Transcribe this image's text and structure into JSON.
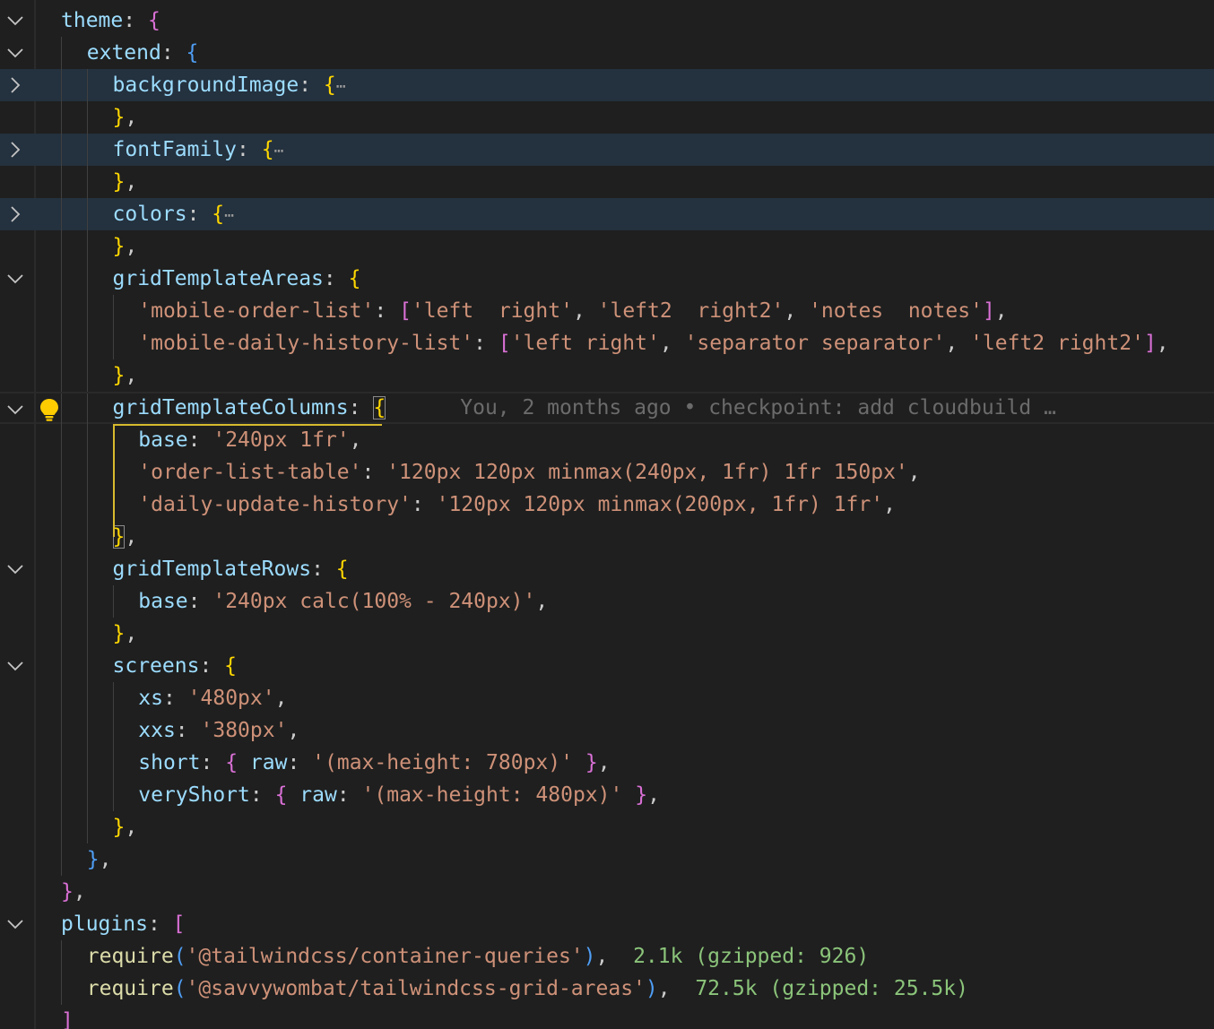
{
  "editor": {
    "lines": [
      {
        "fold": "open",
        "indent": 0,
        "tokens": [
          [
            "k",
            "theme"
          ],
          [
            "p",
            ": "
          ],
          [
            "b1",
            "{"
          ]
        ]
      },
      {
        "fold": "open",
        "indent": 1,
        "tokens": [
          [
            "k",
            "extend"
          ],
          [
            "p",
            ": "
          ],
          [
            "b2",
            "{"
          ]
        ]
      },
      {
        "fold": "closed",
        "indent": 2,
        "collapsed": true,
        "tokens": [
          [
            "k",
            "backgroundImage"
          ],
          [
            "p",
            ": "
          ],
          [
            "b3",
            "{"
          ]
        ],
        "ellipsis": "⋯"
      },
      {
        "indent": 2,
        "tokens": [
          [
            "b3",
            "}"
          ],
          [
            "p",
            ","
          ]
        ]
      },
      {
        "fold": "closed",
        "indent": 2,
        "collapsed": true,
        "tokens": [
          [
            "k",
            "fontFamily"
          ],
          [
            "p",
            ": "
          ],
          [
            "b3",
            "{"
          ]
        ],
        "ellipsis": "⋯"
      },
      {
        "indent": 2,
        "tokens": [
          [
            "b3",
            "}"
          ],
          [
            "p",
            ","
          ]
        ]
      },
      {
        "fold": "closed",
        "indent": 2,
        "collapsed": true,
        "tokens": [
          [
            "k",
            "colors"
          ],
          [
            "p",
            ": "
          ],
          [
            "b3",
            "{"
          ]
        ],
        "ellipsis": "⋯"
      },
      {
        "indent": 2,
        "tokens": [
          [
            "b3",
            "}"
          ],
          [
            "p",
            ","
          ]
        ]
      },
      {
        "fold": "open",
        "indent": 2,
        "tokens": [
          [
            "k",
            "gridTemplateAreas"
          ],
          [
            "p",
            ": "
          ],
          [
            "b3",
            "{"
          ]
        ]
      },
      {
        "indent": 3,
        "tokens": [
          [
            "s",
            "'mobile-order-list'"
          ],
          [
            "p",
            ": "
          ],
          [
            "b1",
            "["
          ],
          [
            "s",
            "'left  right'"
          ],
          [
            "p",
            ", "
          ],
          [
            "s",
            "'left2  right2'"
          ],
          [
            "p",
            ", "
          ],
          [
            "s",
            "'notes  notes'"
          ],
          [
            "b1",
            "]"
          ],
          [
            "p",
            ","
          ]
        ]
      },
      {
        "indent": 3,
        "tokens": [
          [
            "s",
            "'mobile-daily-history-list'"
          ],
          [
            "p",
            ": "
          ],
          [
            "b1",
            "["
          ],
          [
            "s",
            "'left right'"
          ],
          [
            "p",
            ", "
          ],
          [
            "s",
            "'separator separator'"
          ],
          [
            "p",
            ", "
          ],
          [
            "s",
            "'left2 right2'"
          ],
          [
            "b1",
            "]"
          ],
          [
            "p",
            ","
          ]
        ]
      },
      {
        "indent": 2,
        "tokens": [
          [
            "b3",
            "}"
          ],
          [
            "p",
            ","
          ]
        ]
      },
      {
        "fold": "open",
        "indent": 2,
        "current": true,
        "lightbulb": true,
        "tokens": [
          [
            "k",
            "gridTemplateColumns"
          ],
          [
            "p",
            ": "
          ],
          [
            "b3box",
            "{"
          ]
        ],
        "blame": "You, 2 months ago • checkpoint: add cloudbuild …"
      },
      {
        "indent": 3,
        "tokens": [
          [
            "k",
            "base"
          ],
          [
            "p",
            ": "
          ],
          [
            "s",
            "'240px 1fr'"
          ],
          [
            "p",
            ","
          ]
        ]
      },
      {
        "indent": 3,
        "tokens": [
          [
            "s",
            "'order-list-table'"
          ],
          [
            "p",
            ": "
          ],
          [
            "s",
            "'120px 120px minmax(240px, 1fr) 1fr 150px'"
          ],
          [
            "p",
            ","
          ]
        ]
      },
      {
        "indent": 3,
        "tokens": [
          [
            "s",
            "'daily-update-history'"
          ],
          [
            "p",
            ": "
          ],
          [
            "s",
            "'120px 120px minmax(200px, 1fr) 1fr'"
          ],
          [
            "p",
            ","
          ]
        ]
      },
      {
        "indent": 2,
        "tokens": [
          [
            "b3box",
            "}"
          ],
          [
            "p",
            ","
          ]
        ]
      },
      {
        "fold": "open",
        "indent": 2,
        "tokens": [
          [
            "k",
            "gridTemplateRows"
          ],
          [
            "p",
            ": "
          ],
          [
            "b3",
            "{"
          ]
        ]
      },
      {
        "indent": 3,
        "tokens": [
          [
            "k",
            "base"
          ],
          [
            "p",
            ": "
          ],
          [
            "s",
            "'240px calc(100% - 240px)'"
          ],
          [
            "p",
            ","
          ]
        ]
      },
      {
        "indent": 2,
        "tokens": [
          [
            "b3",
            "}"
          ],
          [
            "p",
            ","
          ]
        ]
      },
      {
        "fold": "open",
        "indent": 2,
        "tokens": [
          [
            "k",
            "screens"
          ],
          [
            "p",
            ": "
          ],
          [
            "b3",
            "{"
          ]
        ]
      },
      {
        "indent": 3,
        "tokens": [
          [
            "k",
            "xs"
          ],
          [
            "p",
            ": "
          ],
          [
            "s",
            "'480px'"
          ],
          [
            "p",
            ","
          ]
        ]
      },
      {
        "indent": 3,
        "tokens": [
          [
            "k",
            "xxs"
          ],
          [
            "p",
            ": "
          ],
          [
            "s",
            "'380px'"
          ],
          [
            "p",
            ","
          ]
        ]
      },
      {
        "indent": 3,
        "tokens": [
          [
            "k",
            "short"
          ],
          [
            "p",
            ": "
          ],
          [
            "b1",
            "{"
          ],
          [
            "p",
            " "
          ],
          [
            "k",
            "raw"
          ],
          [
            "p",
            ": "
          ],
          [
            "s",
            "'(max-height: 780px)'"
          ],
          [
            "p",
            " "
          ],
          [
            "b1",
            "}"
          ],
          [
            "p",
            ","
          ]
        ]
      },
      {
        "indent": 3,
        "tokens": [
          [
            "k",
            "veryShort"
          ],
          [
            "p",
            ": "
          ],
          [
            "b1",
            "{"
          ],
          [
            "p",
            " "
          ],
          [
            "k",
            "raw"
          ],
          [
            "p",
            ": "
          ],
          [
            "s",
            "'(max-height: 480px)'"
          ],
          [
            "p",
            " "
          ],
          [
            "b1",
            "}"
          ],
          [
            "p",
            ","
          ]
        ]
      },
      {
        "indent": 2,
        "tokens": [
          [
            "b3",
            "}"
          ],
          [
            "p",
            ","
          ]
        ]
      },
      {
        "indent": 1,
        "tokens": [
          [
            "b2",
            "}"
          ],
          [
            "p",
            ","
          ]
        ]
      },
      {
        "indent": 0,
        "tokens": [
          [
            "b1",
            "}"
          ],
          [
            "p",
            ","
          ]
        ]
      },
      {
        "fold": "open",
        "indent": 0,
        "tokens": [
          [
            "k",
            "plugins"
          ],
          [
            "p",
            ": "
          ],
          [
            "b1",
            "["
          ]
        ]
      },
      {
        "indent": 1,
        "tokens": [
          [
            "f",
            "require"
          ],
          [
            "b2",
            "("
          ],
          [
            "s",
            "'@tailwindcss/container-queries'"
          ],
          [
            "b2",
            ")"
          ],
          [
            "p",
            ","
          ]
        ],
        "hint": "2.1k (gzipped: 926)"
      },
      {
        "indent": 1,
        "tokens": [
          [
            "f",
            "require"
          ],
          [
            "b2",
            "("
          ],
          [
            "s",
            "'@savvywombat/tailwindcss-grid-areas'"
          ],
          [
            "b2",
            ")"
          ],
          [
            "p",
            ","
          ]
        ],
        "hint": "72.5k (gzipped: 25.5k)"
      },
      {
        "indent": 0,
        "tokens": [
          [
            "b1",
            "]"
          ]
        ]
      }
    ]
  }
}
